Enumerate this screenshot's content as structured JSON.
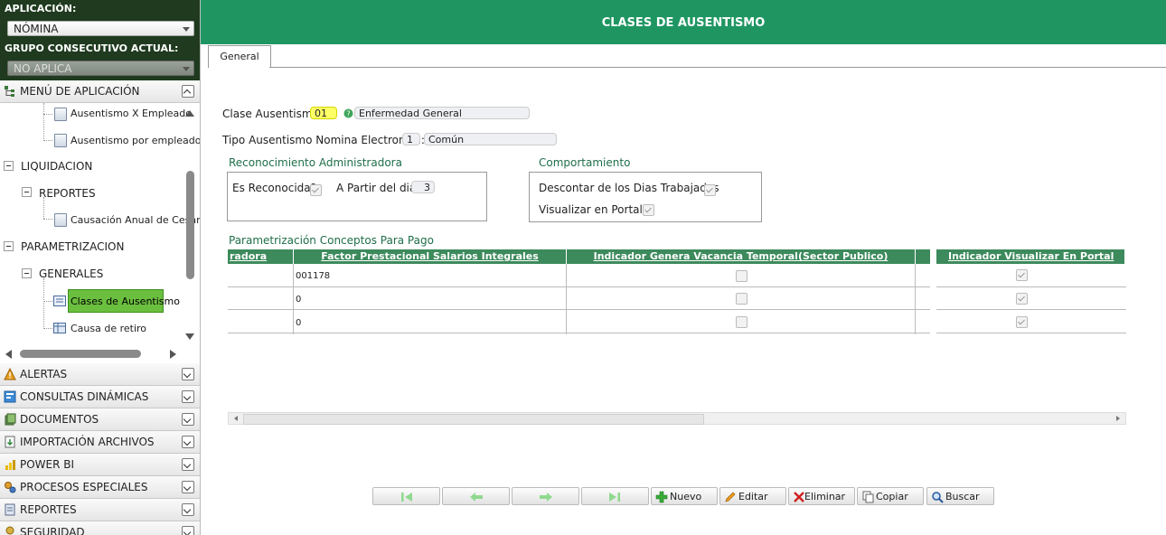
{
  "sidebar": {
    "app_label": "APLICACIÓN:",
    "app_value": "NÓMINA",
    "group_label": "GRUPO CONSECUTIVO ACTUAL:",
    "group_value": "NO APLICA",
    "menu_title": "MENÚ DE APLICACIÓN",
    "tree": {
      "item1": "Ausentismo X Empleado",
      "item2": "Ausentismo por empleado",
      "liquidacion": "LIQUIDACION",
      "reportes": "REPORTES",
      "item3": "Causación Anual de Cesan",
      "parametrizacion": "PARAMETRIZACION",
      "generales": "GENERALES",
      "item4": "Clases de Ausentismo",
      "item5": "Causa de retiro"
    },
    "panels": [
      "ALERTAS",
      "CONSULTAS DINÁMICAS",
      "DOCUMENTOS",
      "IMPORTACIÓN ARCHIVOS",
      "POWER BI",
      "PROCESOS ESPECIALES",
      "REPORTES",
      "SEGURIDAD"
    ]
  },
  "header": {
    "title": "CLASES DE AUSENTISMO"
  },
  "tabs": [
    {
      "label": "General"
    }
  ],
  "form": {
    "clase_label": "Clase Ausentismo:",
    "clase_code": "01",
    "clase_desc": "Enfermedad General",
    "tipo_label": "Tipo Ausentismo Nomina Electronica:",
    "tipo_code": "1",
    "tipo_desc": "Común",
    "reconocimiento": {
      "title": "Reconocimiento Administradora",
      "es_reconocida_label": "Es Reconocida?",
      "es_reconocida_checked": true,
      "a_partir_label": "A Partir del dia",
      "a_partir_value": "3"
    },
    "comportamiento": {
      "title": "Comportamiento",
      "descontar_label": "Descontar de los Dias Trabajados",
      "descontar_checked": true,
      "visualizar_label": "Visualizar en Portal?",
      "visualizar_checked": true
    }
  },
  "grid": {
    "title": "Parametrización Conceptos Para Pago",
    "headers": [
      "radora",
      "Factor Prestacional Salarios Integrales",
      "Indicador Genera Vacancia Temporal(Sector Publico)",
      "Indicador Visualizar En Portal"
    ],
    "rows": [
      {
        "factor": "001178",
        "vacancia": false,
        "portal": true
      },
      {
        "factor": "0",
        "vacancia": false,
        "portal": true
      },
      {
        "factor": "0",
        "vacancia": false,
        "portal": true
      }
    ]
  },
  "toolbar": {
    "nuevo": "Nuevo",
    "editar": "Editar",
    "eliminar": "Eliminar",
    "copiar": "Copiar",
    "buscar": "Buscar"
  },
  "colors": {
    "banner": "#1f9662",
    "grid_header": "#3d8a5c",
    "selected": "#6bbf3f"
  }
}
